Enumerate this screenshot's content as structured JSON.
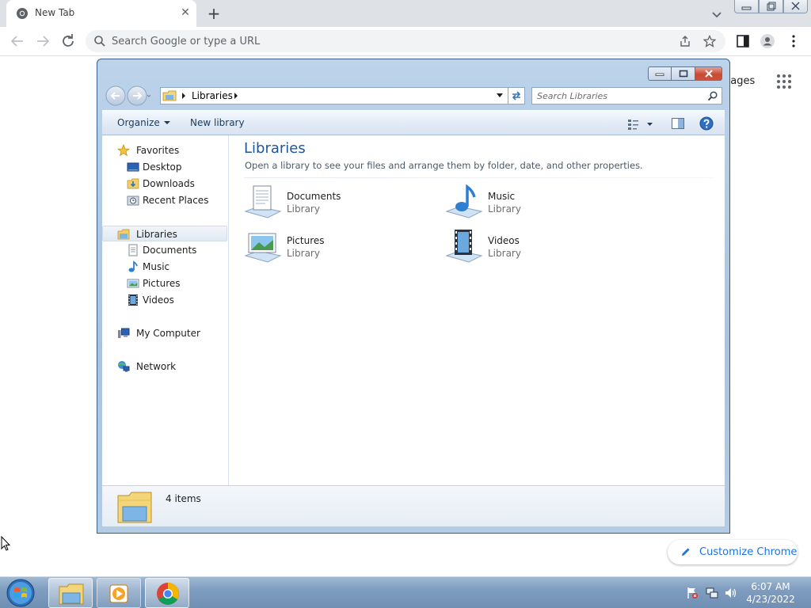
{
  "browser": {
    "tab_title": "New Tab",
    "omnibox_placeholder": "Search Google or type a URL",
    "ntp_images_link": "nages",
    "customize_label": "Customize Chrome"
  },
  "explorer": {
    "address": {
      "crumb": "Libraries"
    },
    "search_placeholder": "Search Libraries",
    "commands": {
      "organize": "Organize",
      "new_library": "New library"
    },
    "nav": {
      "favorites": "Favorites",
      "favorites_items": [
        "Desktop",
        "Downloads",
        "Recent Places"
      ],
      "libraries": "Libraries",
      "libraries_items": [
        "Documents",
        "Music",
        "Pictures",
        "Videos"
      ],
      "computer": "My Computer",
      "network": "Network"
    },
    "content": {
      "title": "Libraries",
      "subtitle": "Open a library to see your files and arrange them by folder, date, and other properties.",
      "tiles": [
        {
          "name": "Documents",
          "type": "Library"
        },
        {
          "name": "Music",
          "type": "Library"
        },
        {
          "name": "Pictures",
          "type": "Library"
        },
        {
          "name": "Videos",
          "type": "Library"
        }
      ]
    },
    "details": {
      "count": "4 items"
    }
  },
  "taskbar": {
    "time": "6:07 AM",
    "date": "4/23/2022"
  },
  "colors": {
    "accent_blue": "#1a73e8",
    "explorer_title": "#1e5799",
    "taskbar": "#7f9dbf"
  }
}
